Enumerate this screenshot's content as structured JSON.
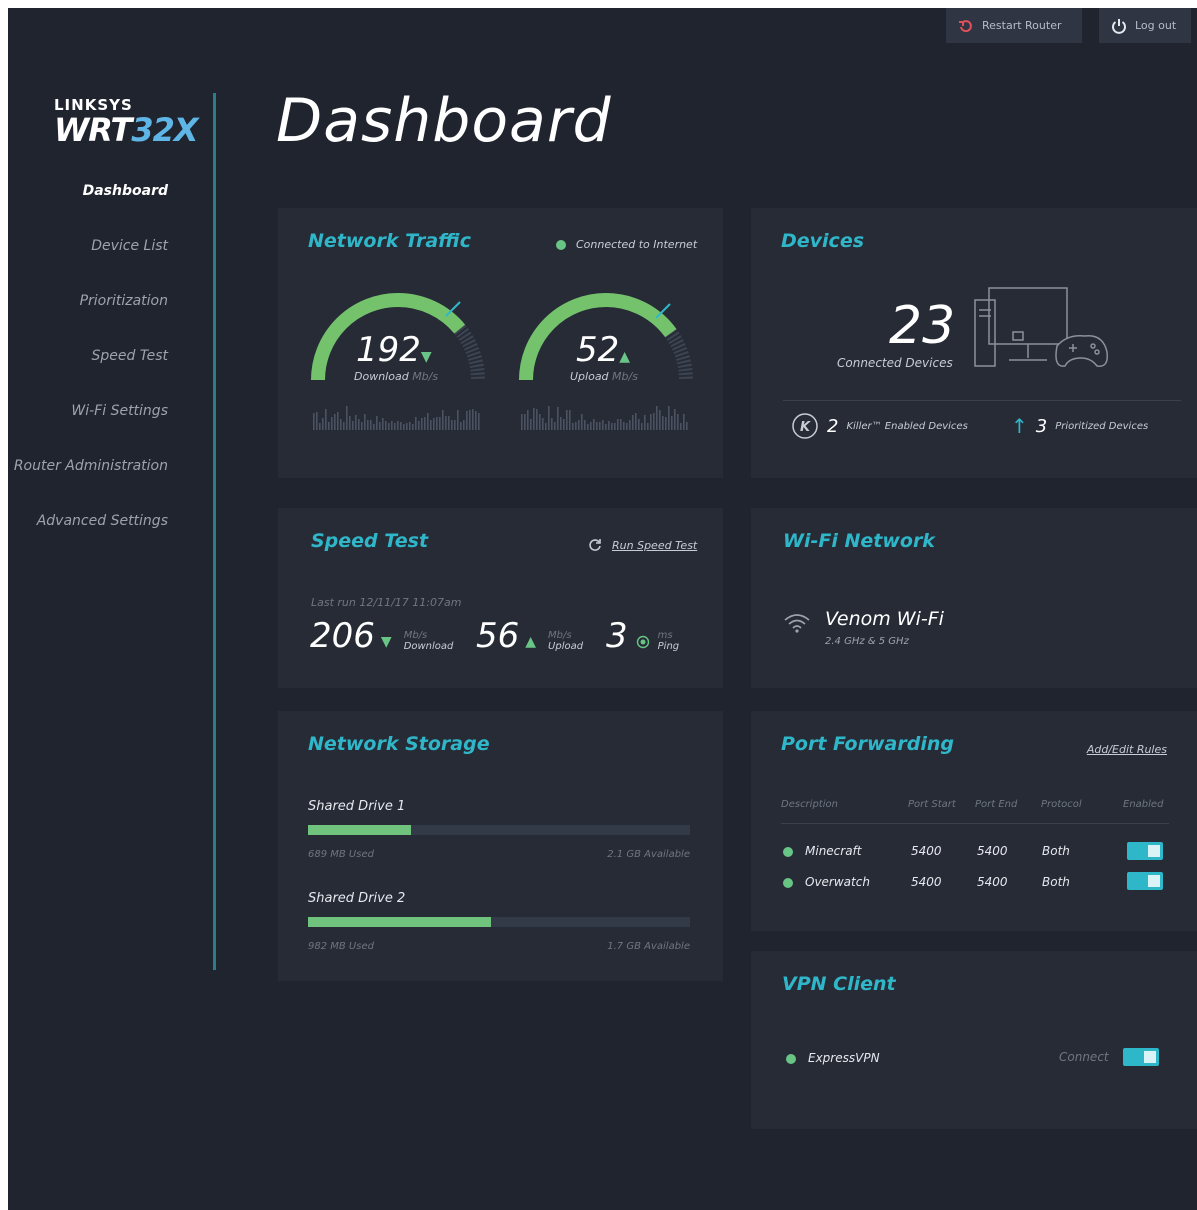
{
  "topbar": {
    "restart_label": "Restart Router",
    "logout_label": "Log out"
  },
  "logo": {
    "brand": "LINKSYS",
    "model_prefix": "WRT",
    "model_suffix": "32X"
  },
  "sidebar": {
    "items": [
      {
        "label": "Dashboard",
        "active": true
      },
      {
        "label": "Device List"
      },
      {
        "label": "Prioritization"
      },
      {
        "label": "Speed Test"
      },
      {
        "label": "Wi-Fi Settings"
      },
      {
        "label": "Router Administration"
      },
      {
        "label": "Advanced Settings"
      }
    ]
  },
  "page_title": "Dashboard",
  "traffic": {
    "title": "Network Traffic",
    "status": "Connected to Internet",
    "download": {
      "value": "192",
      "label": "Download",
      "unit": "Mb/s",
      "fill": 0.78
    },
    "upload": {
      "value": "52",
      "label": "Upload",
      "unit": "Mb/s",
      "fill": 0.8
    }
  },
  "devices": {
    "title": "Devices",
    "count": "23",
    "count_label": "Connected Devices",
    "killer_count": "2",
    "killer_label": "Killer™ Enabled Devices",
    "prioritized_count": "3",
    "prioritized_label": "Prioritized Devices"
  },
  "speedtest": {
    "title": "Speed Test",
    "run_label": "Run Speed Test",
    "last_run": "Last run 12/11/17 11:07am",
    "download": {
      "value": "206",
      "unit": "Mb/s",
      "label": "Download"
    },
    "upload": {
      "value": "56",
      "unit": "Mb/s",
      "label": "Upload"
    },
    "ping": {
      "value": "3",
      "unit": "ms",
      "label": "Ping"
    }
  },
  "wifi": {
    "title": "Wi-Fi Network",
    "name": "Venom Wi-Fi",
    "bands": "2.4 GHz & 5 GHz"
  },
  "storage": {
    "title": "Network Storage",
    "drives": [
      {
        "name": "Shared Drive 1",
        "used": "689 MB Used",
        "available": "2.1 GB Available",
        "fill": 0.27
      },
      {
        "name": "Shared Drive 2",
        "used": "982 MB Used",
        "available": "1.7 GB Available",
        "fill": 0.48
      }
    ]
  },
  "portforwarding": {
    "title": "Port Forwarding",
    "edit_label": "Add/Edit Rules",
    "headers": [
      "Description",
      "Port Start",
      "Port End",
      "Protocol",
      "Enabled"
    ],
    "rows": [
      {
        "description": "Minecraft",
        "start": "5400",
        "end": "5400",
        "protocol": "Both",
        "enabled": true
      },
      {
        "description": "Overwatch",
        "start": "5400",
        "end": "5400",
        "protocol": "Both",
        "enabled": true
      }
    ]
  },
  "vpn": {
    "title": "VPN Client",
    "provider": "ExpressVPN",
    "connect_label": "Connect",
    "connected": true
  },
  "colors": {
    "accent": "#2fb7c9",
    "green": "#69c585",
    "background": "#1f242e",
    "card": "#262b36"
  }
}
